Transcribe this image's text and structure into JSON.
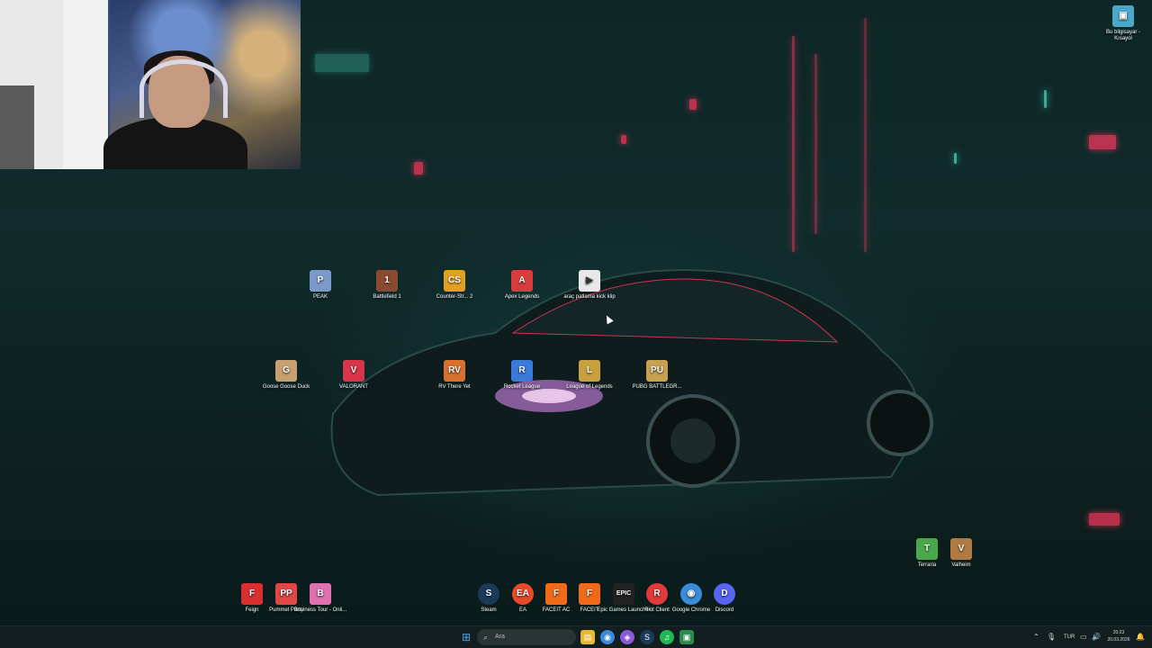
{
  "desktop": {
    "icons": [
      {
        "id": "peak",
        "label": "PEAK",
        "color": "#7c9ac9",
        "glyph": "P"
      },
      {
        "id": "battlefield1",
        "label": "Battlefield 1",
        "color": "#8a4a30",
        "glyph": "1"
      },
      {
        "id": "counterstrike2",
        "label": "Counter-Str... 2",
        "color": "#e0a020",
        "glyph": "CS"
      },
      {
        "id": "apex",
        "label": "Apex Legends",
        "color": "#d83c3c",
        "glyph": "A"
      },
      {
        "id": "arac",
        "label": "araç patlama kick klip",
        "color": "#e8e8e8",
        "glyph": "▶"
      },
      {
        "id": "goose",
        "label": "Goose Goose Duck",
        "color": "#c8a070",
        "glyph": "G"
      },
      {
        "id": "valorant",
        "label": "VALORANT",
        "color": "#d8344a",
        "glyph": "V"
      },
      {
        "id": "rvthereyet",
        "label": "RV There Yet",
        "color": "#d87030",
        "glyph": "RV"
      },
      {
        "id": "rocketleague",
        "label": "Rocket League",
        "color": "#3a7ad8",
        "glyph": "R"
      },
      {
        "id": "lol",
        "label": "League of Legends",
        "color": "#c8a040",
        "glyph": "L"
      },
      {
        "id": "pubg",
        "label": "PUBG BATTLEGR...",
        "color": "#c8a050",
        "glyph": "PU"
      },
      {
        "id": "terraria",
        "label": "Terraria",
        "color": "#4aa84a",
        "glyph": "T"
      },
      {
        "id": "valheim",
        "label": "Valheim",
        "color": "#b07a40",
        "glyph": "V"
      },
      {
        "id": "feign",
        "label": "Feign",
        "color": "#d83030",
        "glyph": "F"
      },
      {
        "id": "pummel",
        "label": "Pummel Party",
        "color": "#e04848",
        "glyph": "PP"
      },
      {
        "id": "business",
        "label": "Business Tour - Onli...",
        "color": "#e070b0",
        "glyph": "B"
      },
      {
        "id": "steam",
        "label": "Steam",
        "color": "#1b3a5a",
        "glyph": "S"
      },
      {
        "id": "ea",
        "label": "EA",
        "color": "#e84a2a",
        "glyph": "EA"
      },
      {
        "id": "faceitac",
        "label": "FACEIT AC",
        "color": "#f06a1a",
        "glyph": "F"
      },
      {
        "id": "faceit",
        "label": "FACEIT",
        "color": "#f06a1a",
        "glyph": "F"
      },
      {
        "id": "epic",
        "label": "Epic Games Launcher",
        "color": "#222222",
        "glyph": "EPIC"
      },
      {
        "id": "riot",
        "label": "Riot Client",
        "color": "#e03a3a",
        "glyph": "R"
      },
      {
        "id": "chrome",
        "label": "Google Chrome",
        "color": "#3a8ad8",
        "glyph": "◉"
      },
      {
        "id": "discord",
        "label": "Discord",
        "color": "#5865f2",
        "glyph": "D"
      },
      {
        "id": "bubilgisayar",
        "label": "Bu bilgisayar - Kısayol",
        "color": "#4aa8c8",
        "glyph": "▣"
      }
    ]
  },
  "taskbar": {
    "search_placeholder": "Ara",
    "search_icon": "magnifier-icon",
    "start_icon": "windows-start-icon",
    "pinned": [
      {
        "id": "explorer",
        "color": "#e8b830",
        "glyph": "▤"
      },
      {
        "id": "chrome",
        "color": "#3a8ad8",
        "glyph": "◉"
      },
      {
        "id": "app2",
        "color": "#8a5ad8",
        "glyph": "◈"
      },
      {
        "id": "steam",
        "color": "#1b3a5a",
        "glyph": "S"
      },
      {
        "id": "spotify",
        "color": "#1db954",
        "glyph": "♫"
      },
      {
        "id": "app5",
        "color": "#2a8a4a",
        "glyph": "▣"
      }
    ],
    "language": "TUR",
    "time": "20:23",
    "date": "20.03.2026"
  }
}
